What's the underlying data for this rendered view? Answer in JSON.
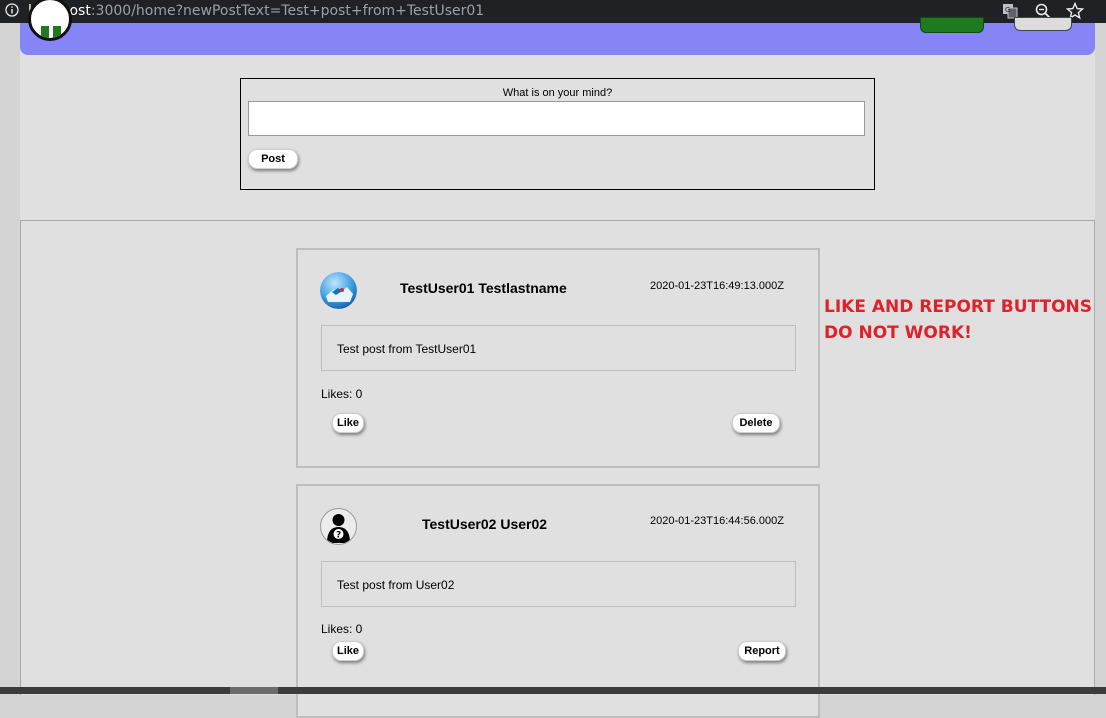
{
  "browser": {
    "url_host": "localhost",
    "url_rest": ":3000/home?newPostText=Test+post+from+TestUser01"
  },
  "compose": {
    "label": "What is on your mind?",
    "value": "",
    "post_label": "Post"
  },
  "posts": [
    {
      "author": "TestUser01 Testlastname",
      "timestamp": "2020-01-23T16:49:13.000Z",
      "text": "Test post from TestUser01",
      "likes_text": "Likes: 0",
      "like_label": "Like",
      "action_label": "Delete",
      "avatar": "landscape-photo-avatar"
    },
    {
      "author": "TestUser02 User02",
      "timestamp": "2020-01-23T16:44:56.000Z",
      "text": "Test post from User02",
      "likes_text": "Likes: 0",
      "like_label": "Like",
      "action_label": "Report",
      "avatar": "unknown-user-avatar"
    }
  ],
  "annotation": {
    "line1": "LIKE AND REPORT BUTTONS",
    "line2": "DO NOT WORK!",
    "color": "#e0202a"
  },
  "colors": {
    "navbar": "#8585f8",
    "page_bg": "#e0e0e0",
    "browser_bar": "#202124"
  }
}
